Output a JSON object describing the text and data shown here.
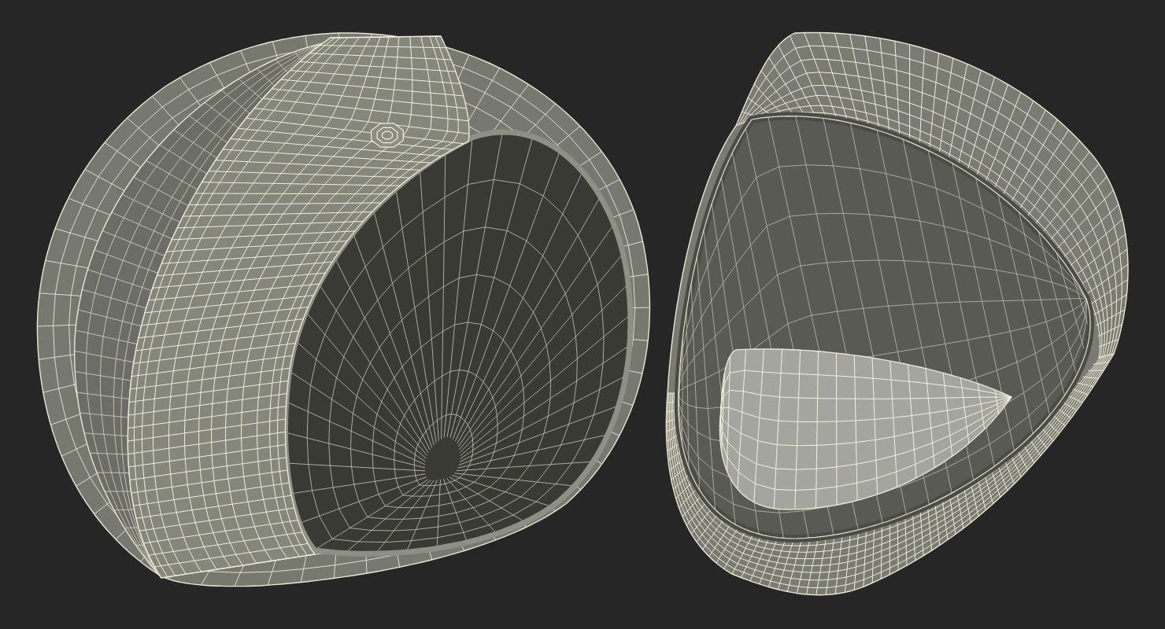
{
  "models": [
    {
      "kind": "open-helmet"
    },
    {
      "kind": "visor-helmet"
    }
  ]
}
